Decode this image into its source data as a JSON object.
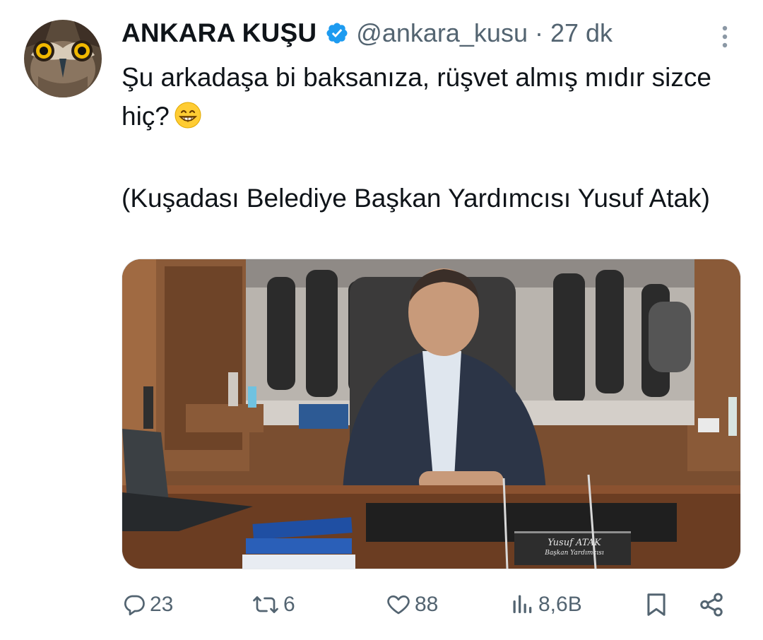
{
  "tweet": {
    "author_name": "ANKARA KUŞU",
    "handle": "@ankara_kusu",
    "separator": "·",
    "time": "27 dk",
    "text_line1": "Şu arkadaşa bi baksanıza, rüşvet almış mıdır sizce hiç?",
    "text_line2": "(Kuşadası Belediye Başkan Yardımcısı Yusuf Atak)",
    "image": {
      "nameplate_name": "Yusuf ATAK",
      "nameplate_title": "Başkan Yardımcısı"
    }
  },
  "actions": {
    "replies": "23",
    "retweets": "6",
    "likes": "88",
    "views": "8,6B"
  },
  "icons": {
    "avatar": "owl-face",
    "verified": "verified-badge-icon",
    "emoji": "grinning-face-emoji",
    "more": "more-vertical-icon",
    "reply": "reply-icon",
    "retweet": "retweet-icon",
    "like": "heart-icon",
    "views": "views-icon",
    "bookmark": "bookmark-icon",
    "share": "share-icon"
  },
  "colors": {
    "text": "#0f1419",
    "secondary": "#536471",
    "verified": "#1d9bf0"
  }
}
